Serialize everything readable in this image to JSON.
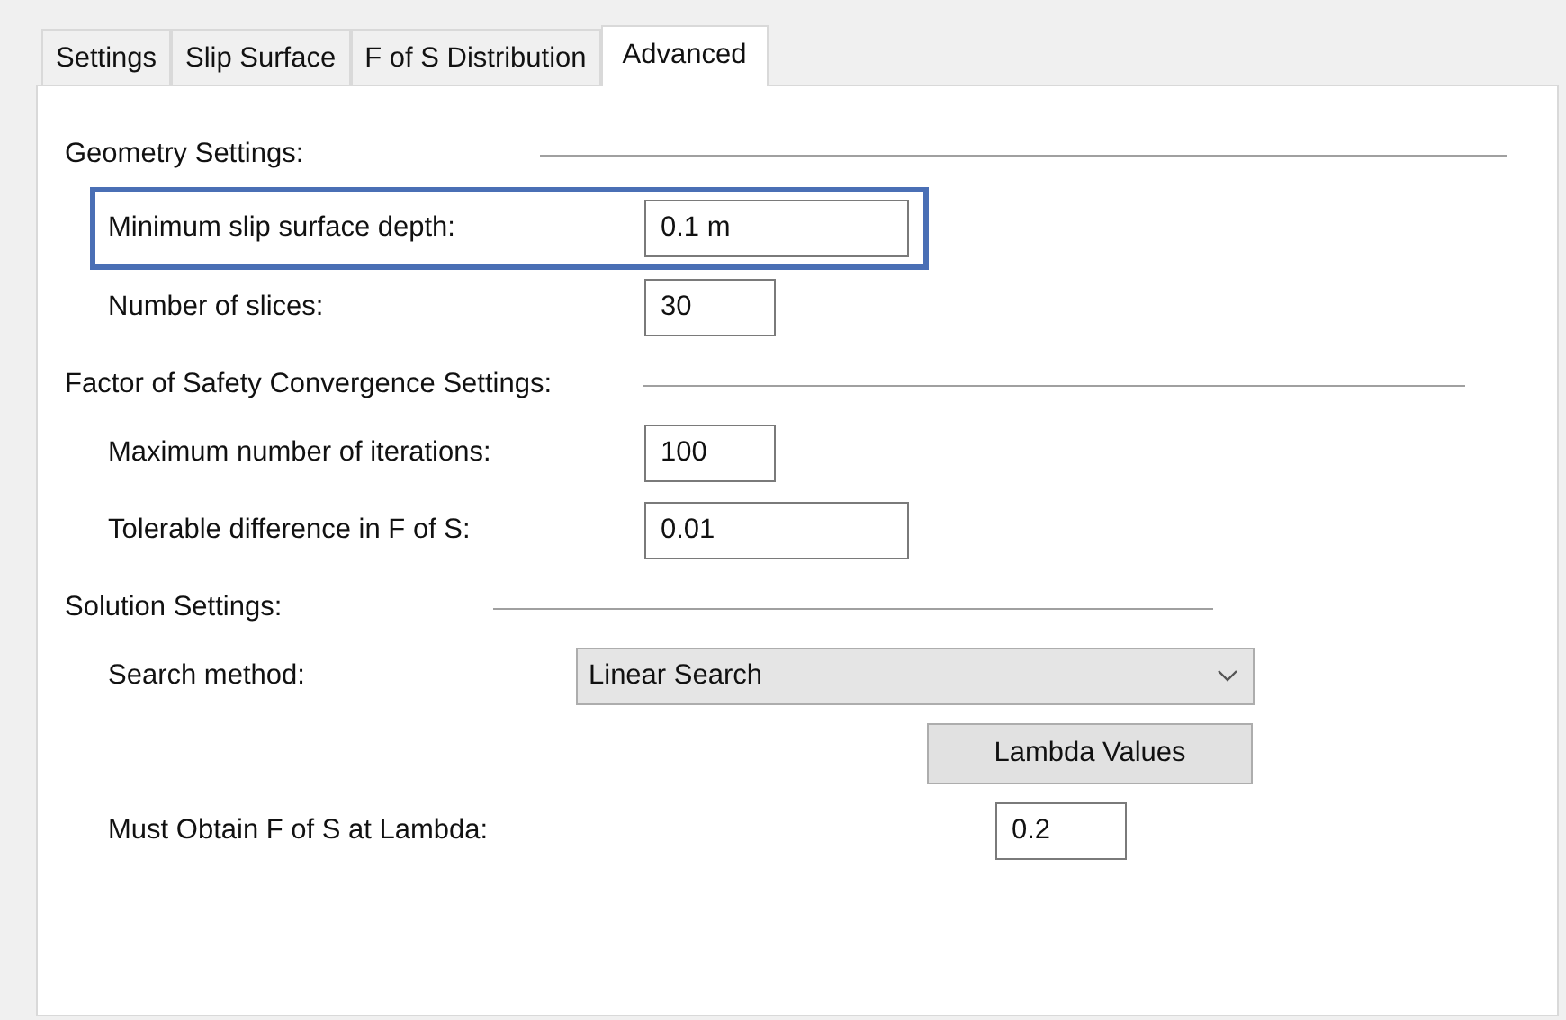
{
  "tabs": [
    {
      "label": "Settings",
      "selected": false
    },
    {
      "label": "Slip Surface",
      "selected": false
    },
    {
      "label": "F of S Distribution",
      "selected": false
    },
    {
      "label": "Advanced",
      "selected": true
    }
  ],
  "sections": [
    {
      "title": "Geometry Settings:",
      "rows": [
        {
          "kind": "long-field",
          "label": "Minimum slip surface depth:",
          "value": "0.1 m",
          "highlighted": true
        },
        {
          "kind": "short-field",
          "label": "Number of slices:",
          "value": "30",
          "highlighted": false
        }
      ]
    },
    {
      "title": "Factor of Safety Convergence Settings:",
      "rows": [
        {
          "kind": "short-field",
          "label": "Maximum number of iterations:",
          "value": "100",
          "highlighted": false
        },
        {
          "kind": "long-field",
          "label": "Tolerable difference in F of S:",
          "value": "0.01",
          "highlighted": false
        }
      ]
    },
    {
      "title": "Solution Settings:",
      "rows": [
        {
          "kind": "dropdown",
          "label": "Search method:",
          "value": "Linear Search"
        },
        {
          "kind": "button",
          "label": "Lambda Values"
        },
        {
          "kind": "far-field",
          "label": "Must Obtain F of S at Lambda:",
          "value": "0.2",
          "highlighted": false
        }
      ]
    }
  ]
}
